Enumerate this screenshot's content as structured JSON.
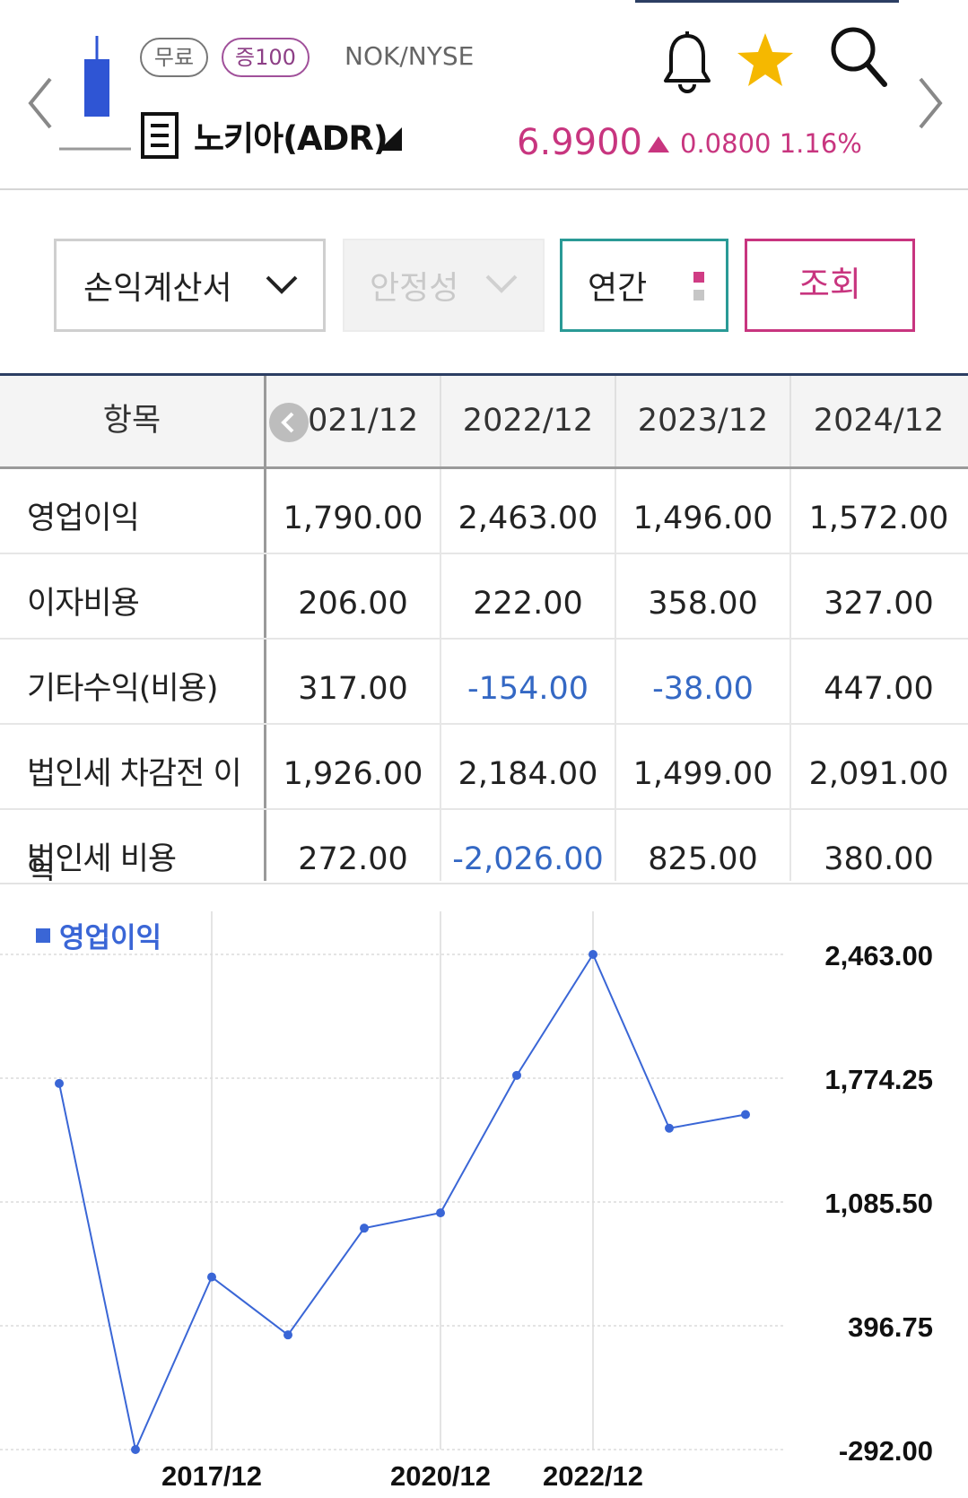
{
  "header": {
    "badge_free": "무료",
    "badge_margin": "증100",
    "exchange": "NOK/NYSE",
    "stock_name": "노키아(ADR)",
    "price": "6.9900",
    "change_amount": "0.0800",
    "change_percent": "1.16%",
    "price_color": "#c8357f"
  },
  "filters": {
    "statement_label": "손익계산서",
    "stability_label": "안정성",
    "period_label": "연간",
    "query_label": "조회"
  },
  "table": {
    "header_item": "항목",
    "columns": [
      "2021/12",
      "2022/12",
      "2023/12",
      "2024/12"
    ],
    "rows": [
      {
        "label": "영업이익",
        "values": [
          "1,790.00",
          "2,463.00",
          "1,496.00",
          "1,572.00"
        ]
      },
      {
        "label": "이자비용",
        "values": [
          "206.00",
          "222.00",
          "358.00",
          "327.00"
        ]
      },
      {
        "label": "기타수익(비용)",
        "values": [
          "317.00",
          "-154.00",
          "-38.00",
          "447.00"
        ]
      },
      {
        "label": "법인세 차감전 이익",
        "values": [
          "1,926.00",
          "2,184.00",
          "1,499.00",
          "2,091.00"
        ]
      },
      {
        "label": "법인세 비용",
        "values": [
          "272.00",
          "-2,026.00",
          "825.00",
          "380.00"
        ]
      }
    ]
  },
  "chart_data": {
    "type": "line",
    "series": [
      {
        "name": "영업이익",
        "values": [
          1745,
          -292,
          668,
          346,
          940,
          1025,
          1790,
          2463,
          1496,
          1572
        ]
      }
    ],
    "x": [
      "2015/12",
      "2016/12",
      "2017/12",
      "2018/12",
      "2019/12",
      "2020/12",
      "2021/12",
      "2022/12",
      "2023/12",
      "2024/12"
    ],
    "x_tick_labels": [
      "2017/12",
      "2020/12",
      "2022/12"
    ],
    "y_tick_labels": [
      "2,463.00",
      "1,774.25",
      "1,085.50",
      "396.75",
      "-292.00"
    ],
    "ylim": [
      -292,
      2463
    ],
    "line_color": "#3a66d6",
    "grid": true
  }
}
